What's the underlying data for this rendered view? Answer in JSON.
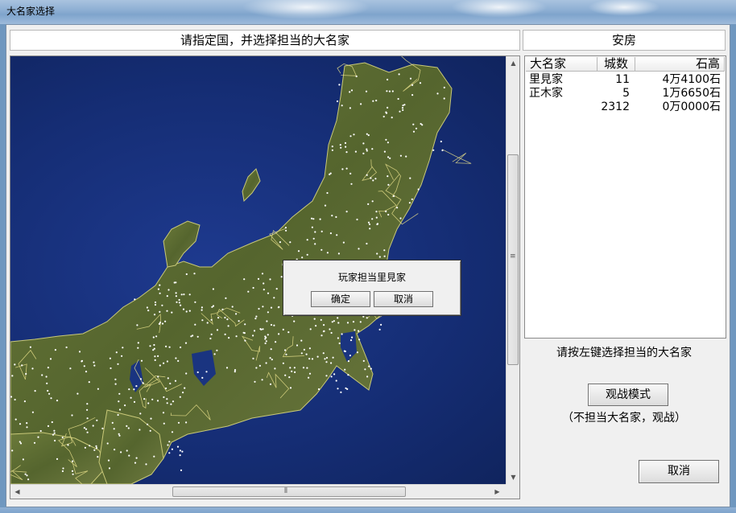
{
  "window": {
    "title": "大名家选择"
  },
  "header": {
    "instruction": "请指定国，并选择担当的大名家",
    "province": "安房"
  },
  "popup": {
    "message": "玩家担当里見家",
    "ok_label": "确定",
    "cancel_label": "取消"
  },
  "clan_table": {
    "columns": [
      "大名家",
      "城数",
      "石高"
    ],
    "rows": [
      {
        "name": "里見家",
        "castles": "11",
        "koku": "4万4100石"
      },
      {
        "name": "正木家",
        "castles": "5",
        "koku": "1万6650石"
      },
      {
        "name": "",
        "castles": "2312",
        "koku": "0万0000石"
      }
    ]
  },
  "sidebar": {
    "instruction": "请按左键选择担当的大名家",
    "watch_button_label": "观战模式",
    "watch_note": "（不担当大名家，观战）",
    "cancel_button_label": "取消"
  },
  "icons": {
    "scroll_up": "scroll-up-arrow-icon",
    "scroll_down": "scroll-down-arrow-icon",
    "scroll_left": "scroll-left-arrow-icon",
    "scroll_right": "scroll-right-arrow-icon"
  },
  "colors": {
    "sea": "#152d74",
    "land": "#5a6a32",
    "border_lines": "#e8e08a",
    "castle_dots": "#ffffff"
  }
}
